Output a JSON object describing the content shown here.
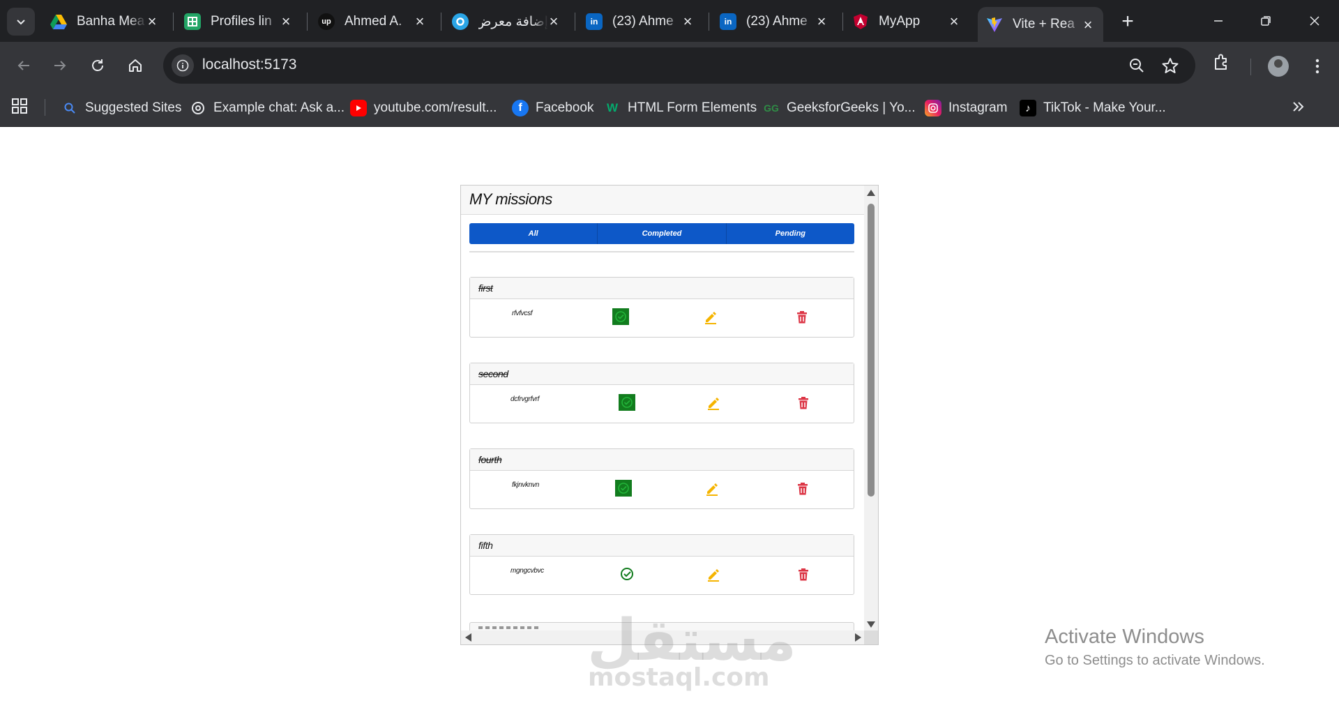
{
  "browser": {
    "tabs": [
      {
        "title": "Banha Mea",
        "favicon": "google-drive-icon"
      },
      {
        "title": "Profiles lin",
        "favicon": "google-sheets-icon"
      },
      {
        "title": "Ahmed A.",
        "favicon": "upwork-icon"
      },
      {
        "title": "إضافة معرض",
        "favicon": "mostaql-icon"
      },
      {
        "title": "(23) Ahme",
        "favicon": "linkedin-icon"
      },
      {
        "title": "(23) Ahme",
        "favicon": "linkedin-icon"
      },
      {
        "title": "MyApp",
        "favicon": "angular-icon"
      },
      {
        "title": "Vite + Rea",
        "favicon": "vite-icon",
        "active": true
      }
    ],
    "address": "localhost:5173",
    "bookmarks": [
      {
        "label": "Suggested Sites",
        "favicon": "search-icon"
      },
      {
        "label": "Example chat: Ask a...",
        "favicon": "openai-icon"
      },
      {
        "label": "youtube.com/result...",
        "favicon": "youtube-icon"
      },
      {
        "label": "Facebook",
        "favicon": "facebook-icon"
      },
      {
        "label": "HTML Form Elements",
        "favicon": "w3schools-icon"
      },
      {
        "label": "GeeksforGeeks | Yo...",
        "favicon": "geeksforgeeks-icon"
      },
      {
        "label": "Instagram",
        "favicon": "instagram-icon"
      },
      {
        "label": "TikTok - Make Your...",
        "favicon": "tiktok-icon"
      }
    ]
  },
  "app": {
    "title": "MY missions",
    "filters": [
      "All",
      "Completed",
      "Pending"
    ],
    "missions": [
      {
        "title": "first",
        "description": "rfvfvcsf",
        "completed": true
      },
      {
        "title": "second",
        "description": "dcfrvgrfvrf",
        "completed": true
      },
      {
        "title": "fourth",
        "description": "fkjnvknvn",
        "completed": true
      },
      {
        "title": "fifth",
        "description": "mgngcvbvc",
        "completed": false
      }
    ]
  },
  "watermark": {
    "arabic": "مستقل",
    "latin": "mostaql.com"
  },
  "system": {
    "activate_title": "Activate Windows",
    "activate_sub": "Go to Settings to activate Windows."
  },
  "colors": {
    "filter_bar": "#0d58c8",
    "check_done": "#127c1e",
    "edit": "#f5b400",
    "delete": "#dc3545"
  }
}
